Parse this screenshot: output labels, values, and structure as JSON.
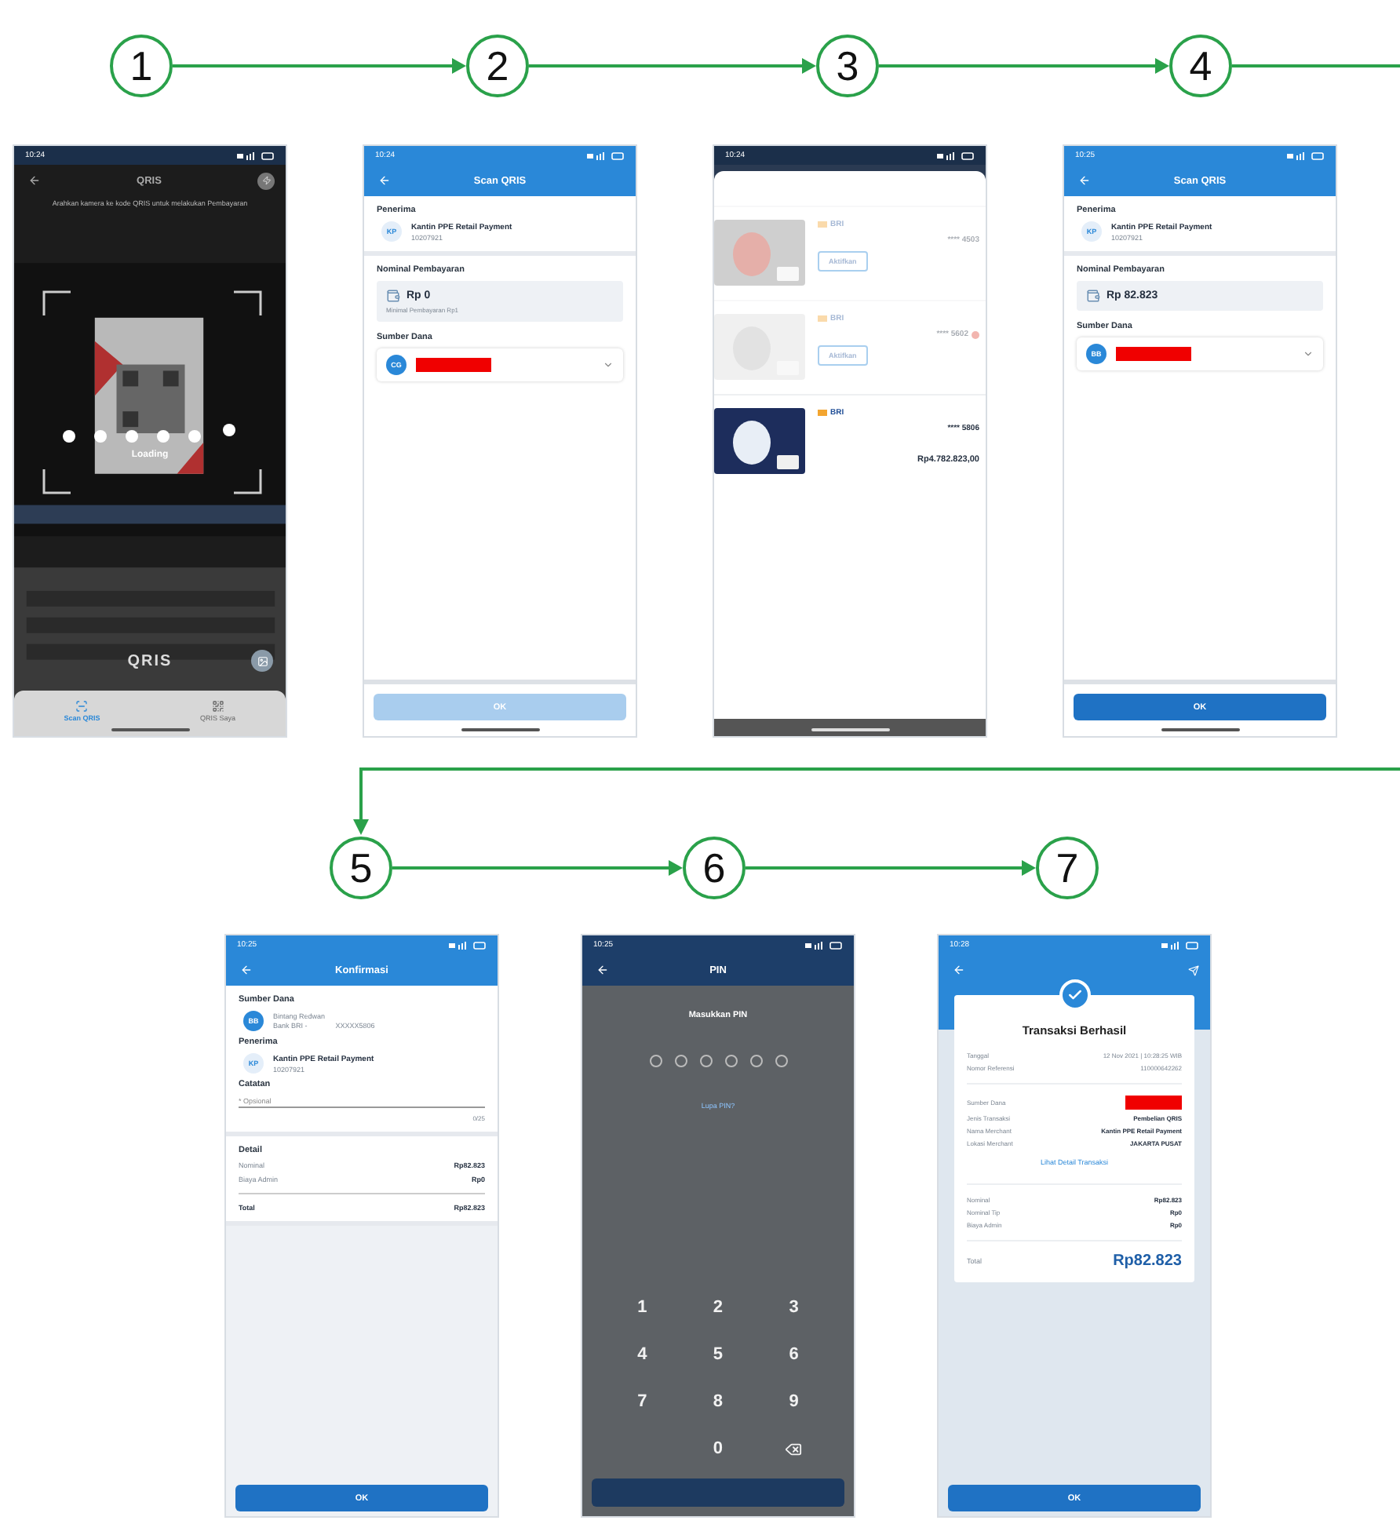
{
  "flow": [
    {
      "step": "1",
      "kind": "camera",
      "status_time": "10:24",
      "title": "QRIS",
      "hint": "Arahkan kamera ke kode QRIS untuk melakukan Pembayaran",
      "loading": "Loading",
      "logo": "QRIS",
      "tabs": [
        {
          "label": "Scan QRIS",
          "selected": true
        },
        {
          "label": "QRIS Saya",
          "selected": false
        }
      ]
    },
    {
      "step": "2",
      "kind": "payment_form",
      "status_time": "10:24",
      "title": "Scan QRIS",
      "recipient_label": "Penerima",
      "recipient": {
        "initials": "KP",
        "name": "Kantin PPE Retail Payment",
        "id": "10207921"
      },
      "amount_label": "Nominal Pembayaran",
      "amount": "Rp 0",
      "amount_hint": "Minimal Pembayaran Rp1",
      "source_label": "Sumber Dana",
      "source": {
        "initials": "CG",
        "redacted": true
      },
      "button": {
        "label": "OK",
        "disabled": true
      }
    },
    {
      "step": "3",
      "kind": "card_list",
      "status_time": "10:24",
      "cards": [
        {
          "bank": "BRI",
          "number": "**** 4503",
          "action": "Aktifkan",
          "dimmed": true,
          "alert": false
        },
        {
          "bank": "BRI",
          "number": "**** 5602",
          "action": "Aktifkan",
          "dimmed": true,
          "alert": true
        },
        {
          "bank": "BRI",
          "number": "**** 5806",
          "balance": "Rp4.782.823,00",
          "dimmed": false,
          "alert": false
        }
      ]
    },
    {
      "step": "4",
      "kind": "payment_form",
      "status_time": "10:25",
      "title": "Scan QRIS",
      "recipient_label": "Penerima",
      "recipient": {
        "initials": "KP",
        "name": "Kantin PPE Retail Payment",
        "id": "10207921"
      },
      "amount_label": "Nominal Pembayaran",
      "amount": "Rp 82.823",
      "source_label": "Sumber Dana",
      "source": {
        "initials": "BB",
        "redacted": true
      },
      "button": {
        "label": "OK",
        "disabled": false
      }
    },
    {
      "step": "5",
      "kind": "confirmation",
      "status_time": "10:25",
      "title": "Konfirmasi",
      "source_label": "Sumber Dana",
      "source": {
        "initials": "BB",
        "name": "Bintang Redwan",
        "bank": "Bank BRI -",
        "account": "XXXXX5806"
      },
      "recipient_label": "Penerima",
      "recipient": {
        "initials": "KP",
        "name": "Kantin PPE Retail Payment",
        "id": "10207921"
      },
      "note_label": "Catatan",
      "note_placeholder": "* Opsional",
      "note_counter": "0/25",
      "detail_label": "Detail",
      "details": [
        {
          "label": "Nominal",
          "value": "Rp82.823"
        },
        {
          "label": "Biaya Admin",
          "value": "Rp0"
        }
      ],
      "total": {
        "label": "Total",
        "value": "Rp82.823"
      },
      "button": {
        "label": "OK",
        "disabled": false
      }
    },
    {
      "step": "6",
      "kind": "pin",
      "status_time": "10:25",
      "title": "PIN",
      "prompt": "Masukkan PIN",
      "pin_dots": [
        {
          "filled": false
        },
        {
          "filled": false
        },
        {
          "filled": false
        },
        {
          "filled": false
        },
        {
          "filled": false
        },
        {
          "filled": false
        }
      ],
      "forgot": "Lupa PIN?",
      "keys": [
        {
          "kind": "digit",
          "label": "1"
        },
        {
          "kind": "digit",
          "label": "2"
        },
        {
          "kind": "digit",
          "label": "3"
        },
        {
          "kind": "digit",
          "label": "4"
        },
        {
          "kind": "digit",
          "label": "5"
        },
        {
          "kind": "digit",
          "label": "6"
        },
        {
          "kind": "digit",
          "label": "7"
        },
        {
          "kind": "digit",
          "label": "8"
        },
        {
          "kind": "digit",
          "label": "9"
        },
        {
          "kind": "blank"
        },
        {
          "kind": "digit",
          "label": "0"
        },
        {
          "kind": "backspace"
        }
      ]
    },
    {
      "step": "7",
      "kind": "receipt",
      "status_time": "10:28",
      "title": "Transaksi Berhasil",
      "info": [
        {
          "label": "Tanggal",
          "value": "12 Nov 2021 | 10:28:25 WIB"
        },
        {
          "label": "Nomor Referensi",
          "value": "110000642262"
        }
      ],
      "details": [
        {
          "label": "Sumber Dana",
          "redacted": true
        },
        {
          "label": "Jenis Transaksi",
          "value": "Pembelian QRIS",
          "redacted": false
        },
        {
          "label": "Nama Merchant",
          "value": "Kantin PPE Retail Payment",
          "redacted": false
        },
        {
          "label": "Lokasi Merchant",
          "value": "JAKARTA PUSAT",
          "redacted": false
        }
      ],
      "link": "Lihat Detail Transaksi",
      "amounts": [
        {
          "label": "Nominal",
          "value": "Rp82.823"
        },
        {
          "label": "Nominal Tip",
          "value": "Rp0"
        },
        {
          "label": "Biaya Admin",
          "value": "Rp0"
        }
      ],
      "total": {
        "label": "Total",
        "value": "Rp82.823"
      },
      "button": {
        "label": "OK",
        "disabled": false
      }
    }
  ]
}
